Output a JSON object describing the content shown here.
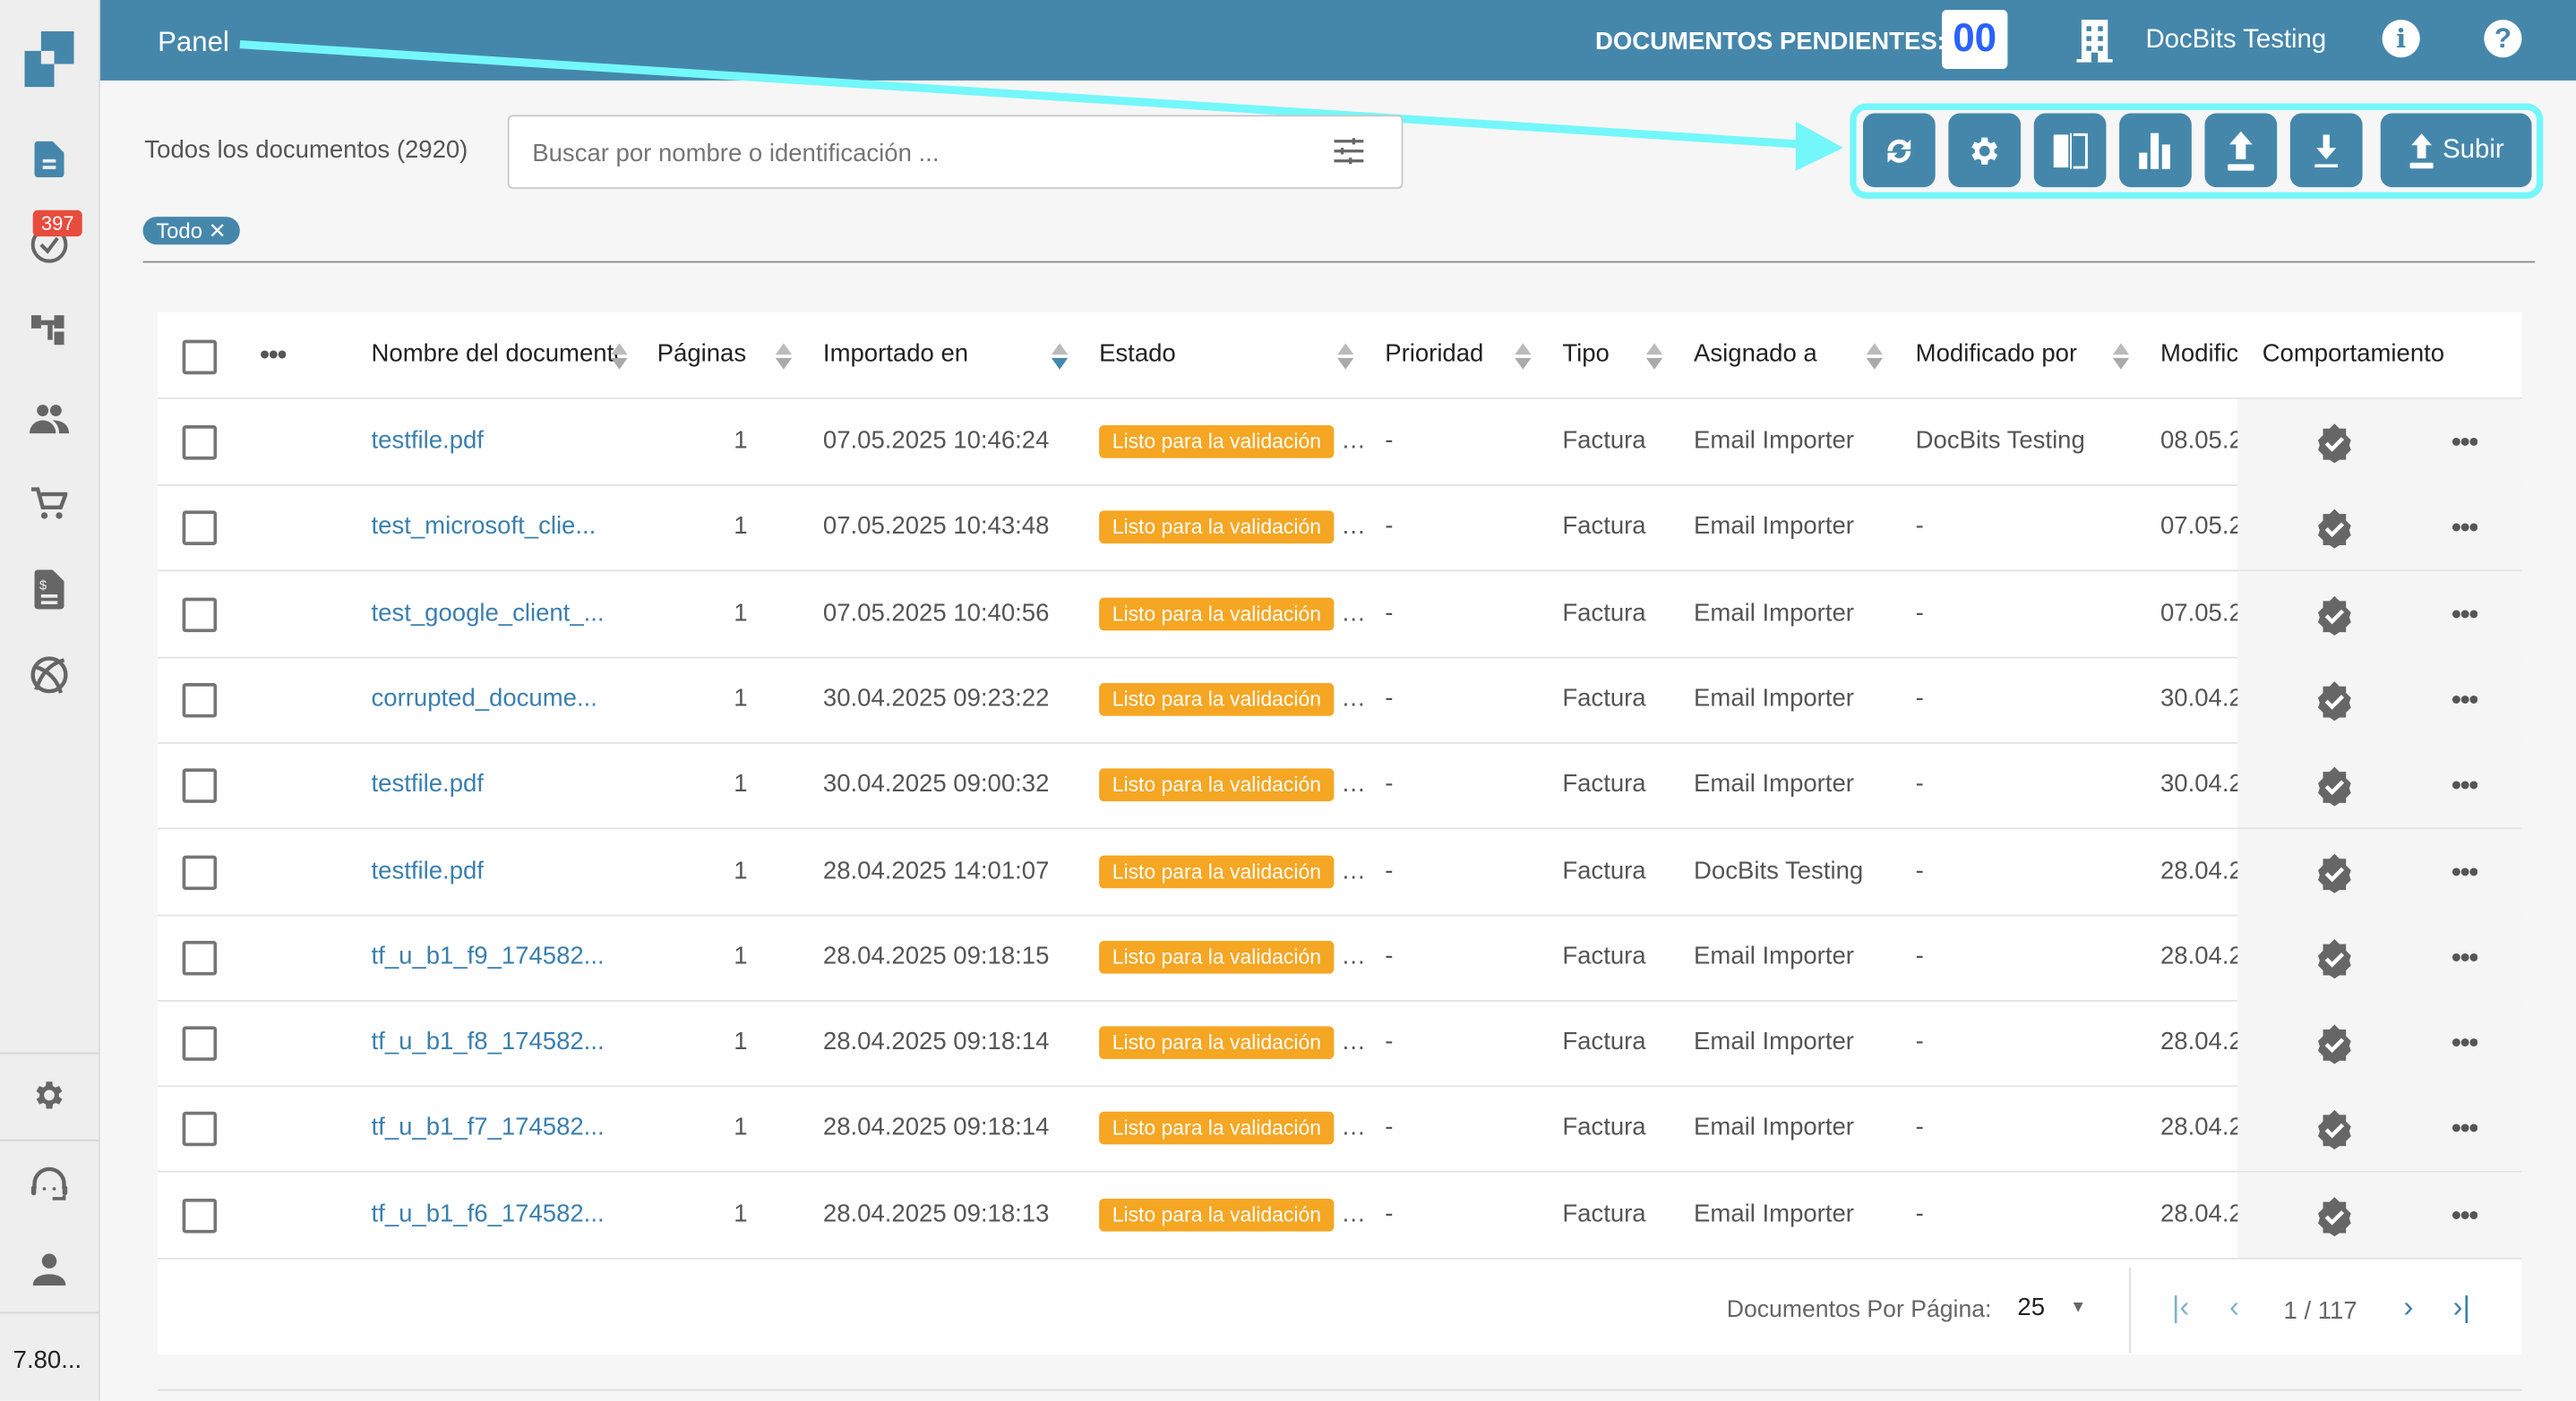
{
  "sidebar": {
    "badge_count": "397",
    "version": "7.80..."
  },
  "header": {
    "title": "Panel",
    "pending_label": "DOCUMENTOS PENDIENTES:",
    "pending_count": "00",
    "org_name": "DocBits Testing"
  },
  "toolbar": {
    "documents_label": "Todos los documentos (2920)",
    "search_placeholder": "Buscar por nombre o identificación ...",
    "filter_chip": "Todo",
    "upload_label": "Subir"
  },
  "table": {
    "columns": [
      "Nombre del documento",
      "Páginas",
      "Importado en",
      "Estado",
      "Prioridad",
      "Tipo",
      "Asignado a",
      "Modificado por",
      "Modific",
      "Comportamiento"
    ],
    "rows": [
      {
        "name": "testfile.pdf",
        "pages": "1",
        "imported": "07.05.2025 10:46:24",
        "status": "Listo para la validación",
        "priority": "-",
        "type": "Factura",
        "assigned": "Email Importer",
        "modified_by": "DocBits Testing",
        "modified": "08.05.2"
      },
      {
        "name": "test_microsoft_clie...",
        "pages": "1",
        "imported": "07.05.2025 10:43:48",
        "status": "Listo para la validación",
        "priority": "-",
        "type": "Factura",
        "assigned": "Email Importer",
        "modified_by": "-",
        "modified": "07.05.2"
      },
      {
        "name": "test_google_client_...",
        "pages": "1",
        "imported": "07.05.2025 10:40:56",
        "status": "Listo para la validación",
        "priority": "-",
        "type": "Factura",
        "assigned": "Email Importer",
        "modified_by": "-",
        "modified": "07.05.2"
      },
      {
        "name": "corrupted_docume...",
        "pages": "1",
        "imported": "30.04.2025 09:23:22",
        "status": "Listo para la validación",
        "priority": "-",
        "type": "Factura",
        "assigned": "Email Importer",
        "modified_by": "-",
        "modified": "30.04.2"
      },
      {
        "name": "testfile.pdf",
        "pages": "1",
        "imported": "30.04.2025 09:00:32",
        "status": "Listo para la validación",
        "priority": "-",
        "type": "Factura",
        "assigned": "Email Importer",
        "modified_by": "-",
        "modified": "30.04.2"
      },
      {
        "name": "testfile.pdf",
        "pages": "1",
        "imported": "28.04.2025 14:01:07",
        "status": "Listo para la validación",
        "priority": "-",
        "type": "Factura",
        "assigned": "DocBits Testing",
        "modified_by": "-",
        "modified": "28.04.2"
      },
      {
        "name": "tf_u_b1_f9_174582...",
        "pages": "1",
        "imported": "28.04.2025 09:18:15",
        "status": "Listo para la validación",
        "priority": "-",
        "type": "Factura",
        "assigned": "Email Importer",
        "modified_by": "-",
        "modified": "28.04.2"
      },
      {
        "name": "tf_u_b1_f8_174582...",
        "pages": "1",
        "imported": "28.04.2025 09:18:14",
        "status": "Listo para la validación",
        "priority": "-",
        "type": "Factura",
        "assigned": "Email Importer",
        "modified_by": "-",
        "modified": "28.04.2"
      },
      {
        "name": "tf_u_b1_f7_174582...",
        "pages": "1",
        "imported": "28.04.2025 09:18:14",
        "status": "Listo para la validación",
        "priority": "-",
        "type": "Factura",
        "assigned": "Email Importer",
        "modified_by": "-",
        "modified": "28.04.2"
      },
      {
        "name": "tf_u_b1_f6_174582...",
        "pages": "1",
        "imported": "28.04.2025 09:18:13",
        "status": "Listo para la validación",
        "priority": "-",
        "type": "Factura",
        "assigned": "Email Importer",
        "modified_by": "-",
        "modified": "28.04.2"
      }
    ]
  },
  "pagination": {
    "per_page_label": "Documentos Por Página:",
    "per_page": "25",
    "page_info": "1 / 117"
  },
  "colors": {
    "brand": "#4587ab",
    "highlight": "#74f7fa",
    "status": "#f5a623",
    "badge": "#e74c3c"
  }
}
